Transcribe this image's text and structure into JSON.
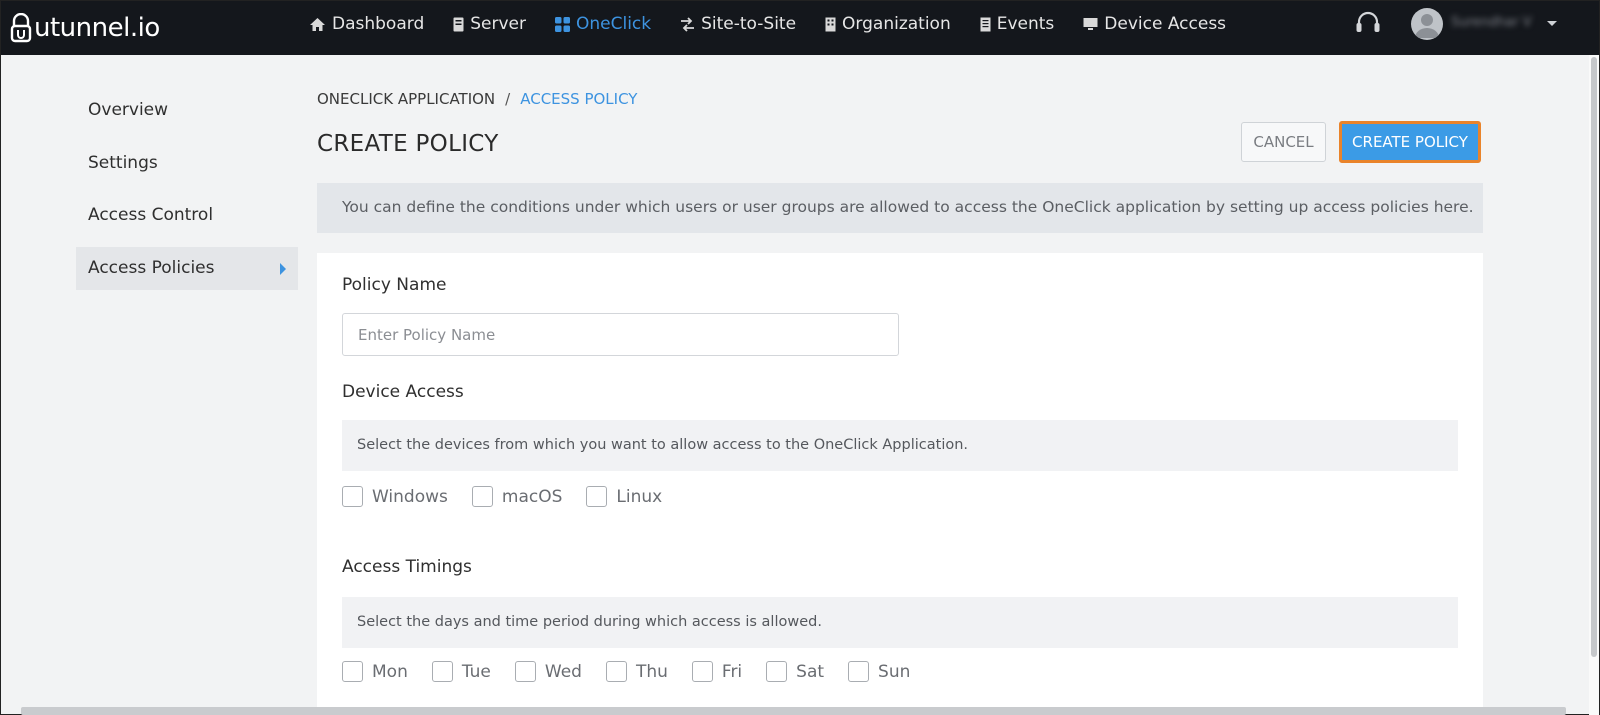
{
  "brand": {
    "logo_text": "utunnel.io"
  },
  "nav": {
    "items": [
      {
        "label": "Dashboard",
        "icon": "home-icon"
      },
      {
        "label": "Server",
        "icon": "server-icon"
      },
      {
        "label": "OneClick",
        "icon": "grid-icon"
      },
      {
        "label": "Site-to-Site",
        "icon": "arrows-icon"
      },
      {
        "label": "Organization",
        "icon": "building-icon"
      },
      {
        "label": "Events",
        "icon": "document-icon"
      },
      {
        "label": "Device Access",
        "icon": "monitor-icon"
      }
    ],
    "active": "OneClick",
    "user_name": "Surendhar V"
  },
  "sidebar": {
    "items": [
      {
        "label": "Overview"
      },
      {
        "label": "Settings"
      },
      {
        "label": "Access Control"
      },
      {
        "label": "Access Policies"
      }
    ],
    "active": "Access Policies"
  },
  "breadcrumb": {
    "parent": "ONECLICK APPLICATION",
    "separator": "/",
    "current": "ACCESS POLICY"
  },
  "page": {
    "title": "CREATE POLICY",
    "cancel_label": "CANCEL",
    "create_label": "CREATE POLICY",
    "info": "You can define the conditions under which users or user groups are allowed to access the OneClick application by setting up access policies here."
  },
  "form": {
    "policy_name": {
      "label": "Policy Name",
      "placeholder": "Enter Policy Name",
      "value": ""
    },
    "device_access": {
      "label": "Device Access",
      "hint": "Select the devices from which you want to allow access to the OneClick Application.",
      "options": [
        {
          "label": "Windows",
          "checked": false
        },
        {
          "label": "macOS",
          "checked": false
        },
        {
          "label": "Linux",
          "checked": false
        }
      ]
    },
    "access_timings": {
      "label": "Access Timings",
      "hint": "Select the days and time period during which access is allowed.",
      "days": [
        {
          "label": "Mon",
          "checked": false
        },
        {
          "label": "Tue",
          "checked": false
        },
        {
          "label": "Wed",
          "checked": false
        },
        {
          "label": "Thu",
          "checked": false
        },
        {
          "label": "Fri",
          "checked": false
        },
        {
          "label": "Sat",
          "checked": false
        },
        {
          "label": "Sun",
          "checked": false
        }
      ]
    }
  },
  "colors": {
    "topbar": "#14171c",
    "accent": "#3d93e0",
    "primary_button": "#3b9be6",
    "highlight_border": "#e9832a"
  }
}
